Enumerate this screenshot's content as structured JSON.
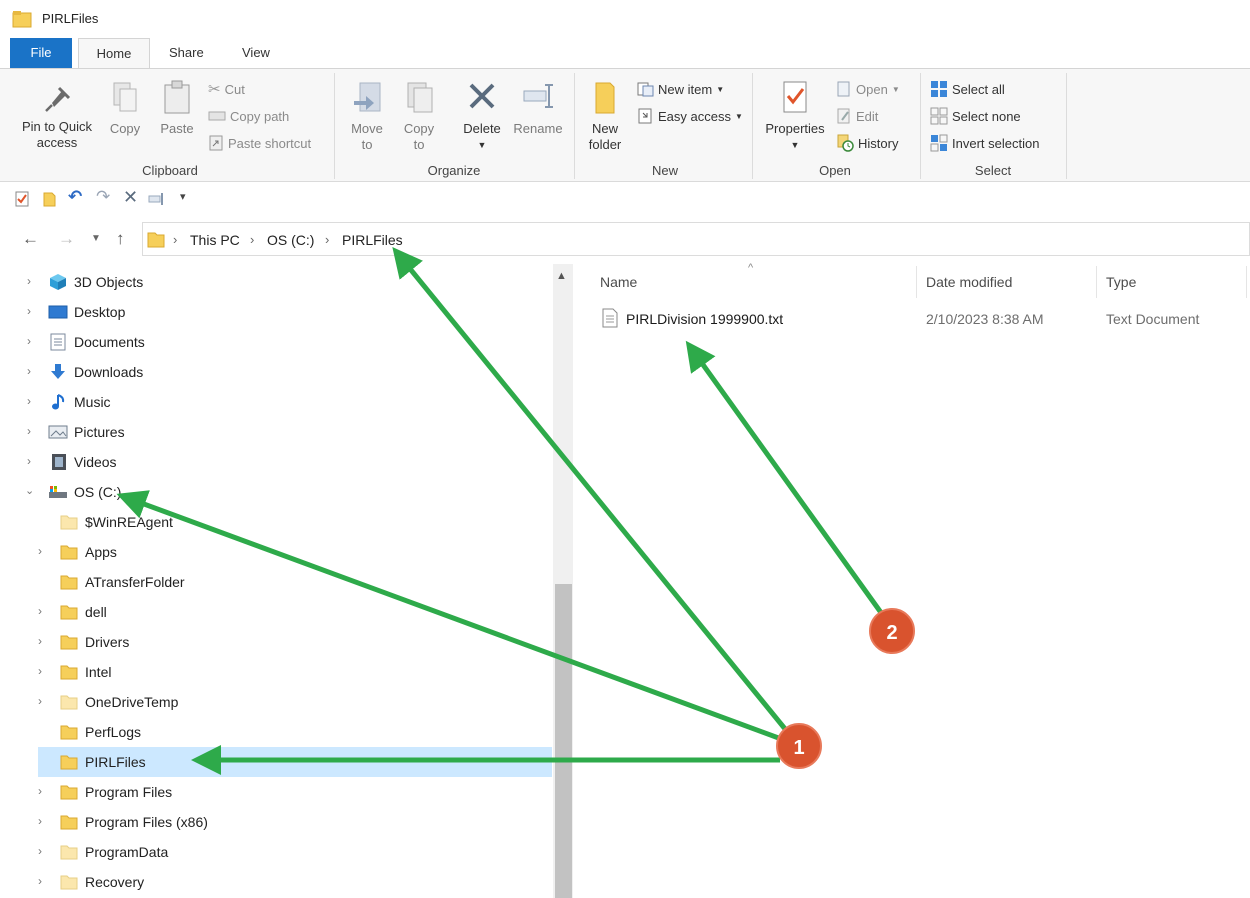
{
  "window": {
    "title": "PIRLFiles"
  },
  "ribbon": {
    "tabs": [
      "File",
      "Home",
      "Share",
      "View"
    ],
    "clipboard": {
      "pin_label": "Pin to Quick\naccess",
      "copy_label": "Copy",
      "paste_label": "Paste",
      "cut_label": "Cut",
      "copy_path_label": "Copy path",
      "paste_shortcut_label": "Paste shortcut",
      "group_label": "Clipboard"
    },
    "organize": {
      "move_to_label": "Move\nto",
      "copy_to_label": "Copy\nto",
      "delete_label": "Delete",
      "rename_label": "Rename",
      "group_label": "Organize"
    },
    "new": {
      "new_folder_label": "New\nfolder",
      "new_item_label": "New item",
      "easy_access_label": "Easy access",
      "group_label": "New"
    },
    "open": {
      "properties_label": "Properties",
      "open_label": "Open",
      "edit_label": "Edit",
      "history_label": "History",
      "group_label": "Open"
    },
    "select": {
      "select_all_label": "Select all",
      "select_none_label": "Select none",
      "invert_selection_label": "Invert selection",
      "group_label": "Select"
    }
  },
  "address": {
    "breadcrumbs": [
      "This PC",
      "OS (C:)",
      "PIRLFiles"
    ]
  },
  "nav_pane": {
    "items": [
      {
        "label": "3D Objects",
        "icon": "3d-objects-icon"
      },
      {
        "label": "Desktop",
        "icon": "desktop-icon"
      },
      {
        "label": "Documents",
        "icon": "documents-icon"
      },
      {
        "label": "Downloads",
        "icon": "downloads-icon"
      },
      {
        "label": "Music",
        "icon": "music-icon"
      },
      {
        "label": "Pictures",
        "icon": "pictures-icon"
      },
      {
        "label": "Videos",
        "icon": "videos-icon"
      },
      {
        "label": "OS (C:)",
        "icon": "drive-icon"
      },
      {
        "label": "$WinREAgent",
        "icon": "folder-icon"
      },
      {
        "label": "Apps",
        "icon": "folder-icon"
      },
      {
        "label": "ATransferFolder",
        "icon": "folder-icon"
      },
      {
        "label": "dell",
        "icon": "folder-icon"
      },
      {
        "label": "Drivers",
        "icon": "folder-icon"
      },
      {
        "label": "Intel",
        "icon": "folder-icon"
      },
      {
        "label": "OneDriveTemp",
        "icon": "folder-icon"
      },
      {
        "label": "PerfLogs",
        "icon": "folder-icon"
      },
      {
        "label": "PIRLFiles",
        "icon": "folder-icon"
      },
      {
        "label": "Program Files",
        "icon": "folder-icon"
      },
      {
        "label": "Program Files (x86)",
        "icon": "folder-icon"
      },
      {
        "label": "ProgramData",
        "icon": "folder-icon"
      },
      {
        "label": "Recovery",
        "icon": "folder-icon"
      }
    ]
  },
  "details": {
    "columns": [
      "Name",
      "Date modified",
      "Type"
    ],
    "files": [
      {
        "name": "PIRLDivision 1999900.txt",
        "date_modified": "2/10/2023 8:38 AM",
        "type": "Text Document"
      }
    ]
  },
  "annotations": {
    "badge_1": "1",
    "badge_2": "2",
    "arrow_color": "#2eaa4a",
    "badge_color": "#d9532e"
  },
  "colors": {
    "file_tab": "#1a73c7",
    "selection": "#cce8ff",
    "folder": "#f6cf5a"
  }
}
